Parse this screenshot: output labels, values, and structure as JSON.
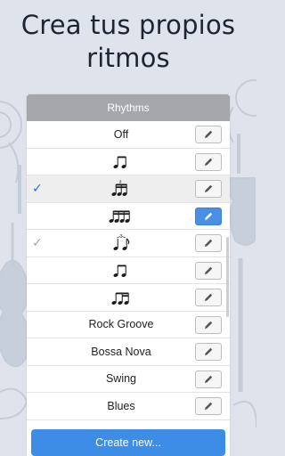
{
  "headline": {
    "line1": "Crea tus propios",
    "line2": "ritmos"
  },
  "panel": {
    "title": "Rhythms"
  },
  "rhythms": [
    {
      "label": "Off",
      "icon": "",
      "check": "none",
      "edit_primary": false
    },
    {
      "label": "",
      "icon": "eighth-notes-icon",
      "check": "none",
      "edit_primary": false
    },
    {
      "label": "",
      "icon": "triplet-sixteenths-icon",
      "check": "active",
      "edit_primary": false
    },
    {
      "label": "",
      "icon": "four-sixteenths-icon",
      "check": "none",
      "edit_primary": true
    },
    {
      "label": "",
      "icon": "swing-triplet-icon",
      "check": "dim",
      "edit_primary": false
    },
    {
      "label": "",
      "icon": "eighth-notes-icon",
      "check": "none",
      "edit_primary": false
    },
    {
      "label": "",
      "icon": "eighth-two-sixteenths-icon",
      "check": "none",
      "edit_primary": false
    },
    {
      "label": "Rock Groove",
      "icon": "",
      "check": "none",
      "edit_primary": false
    },
    {
      "label": "Bossa Nova",
      "icon": "",
      "check": "none",
      "edit_primary": false
    },
    {
      "label": "Swing",
      "icon": "",
      "check": "none",
      "edit_primary": false
    },
    {
      "label": "Blues",
      "icon": "",
      "check": "none",
      "edit_primary": false
    }
  ],
  "triplet_mark": "3",
  "check_glyph": "✓",
  "create_button": {
    "label": "Create new..."
  },
  "colors": {
    "accent": "#3d8ce6",
    "check": "#1f6fe0",
    "header": "#a5a7aa",
    "background": "#dfe4ec"
  }
}
